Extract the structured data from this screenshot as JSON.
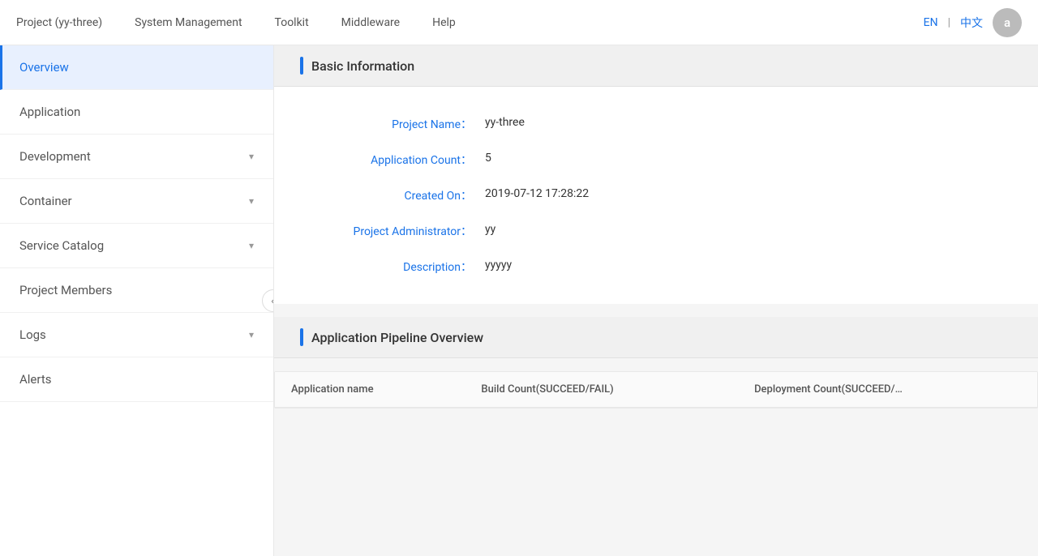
{
  "topnav": {
    "project_label": "Project  (yy-three)",
    "items": [
      {
        "label": "System Management"
      },
      {
        "label": "Toolkit"
      },
      {
        "label": "Middleware"
      },
      {
        "label": "Help"
      }
    ],
    "lang_en": "EN",
    "lang_sep": "|",
    "lang_zh": "中文",
    "avatar_letter": "a"
  },
  "sidebar": {
    "items": [
      {
        "label": "Overview",
        "active": true,
        "has_chevron": false
      },
      {
        "label": "Application",
        "active": false,
        "has_chevron": false
      },
      {
        "label": "Development",
        "active": false,
        "has_chevron": true
      },
      {
        "label": "Container",
        "active": false,
        "has_chevron": true
      },
      {
        "label": "Service Catalog",
        "active": false,
        "has_chevron": true
      },
      {
        "label": "Project Members",
        "active": false,
        "has_chevron": false
      },
      {
        "label": "Logs",
        "active": false,
        "has_chevron": true
      },
      {
        "label": "Alerts",
        "active": false,
        "has_chevron": false
      }
    ],
    "collapse_icon": "«"
  },
  "basic_info": {
    "section_title": "Basic Information",
    "fields": [
      {
        "label": "Project Name：",
        "value": "yy-three"
      },
      {
        "label": "Application Count：",
        "value": "5"
      },
      {
        "label": "Created On：",
        "value": "2019-07-12 17:28:22"
      },
      {
        "label": "Project Administrator：",
        "value": "yy"
      },
      {
        "label": "Description：",
        "value": "yyyyy"
      }
    ]
  },
  "pipeline": {
    "section_title": "Application Pipeline Overview",
    "columns": [
      {
        "label": "Application name"
      },
      {
        "label": "Build Count(SUCCEED/FAIL)"
      },
      {
        "label": "Deployment Count(SUCCEED/…"
      }
    ]
  }
}
